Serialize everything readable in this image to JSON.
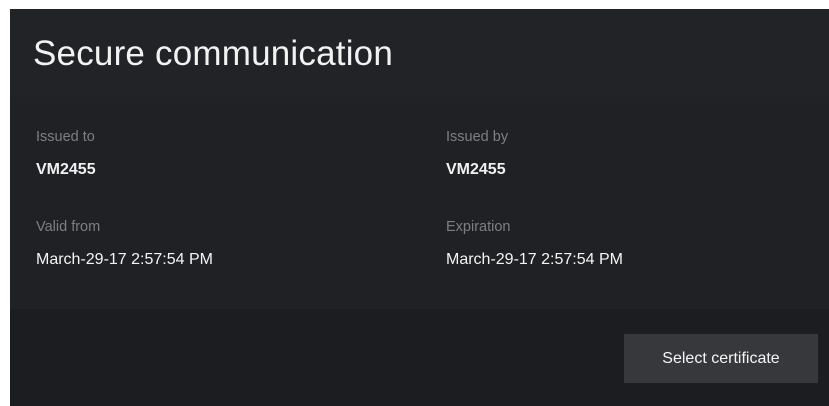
{
  "panel": {
    "title": "Secure communication"
  },
  "certificate": {
    "issued_to": {
      "label": "Issued to",
      "value": "VM2455"
    },
    "issued_by": {
      "label": "Issued by",
      "value": "VM2455"
    },
    "valid_from": {
      "label": "Valid from",
      "value": "March-29-17 2:57:54 PM"
    },
    "expiration": {
      "label": "Expiration",
      "value": "March-29-17 2:57:54 PM"
    }
  },
  "actions": {
    "select_certificate_label": "Select certificate"
  },
  "colors": {
    "panel_background": "#1f2124",
    "label_text": "#7c7f84",
    "value_text": "#f1f1f1",
    "button_background": "#36383c"
  }
}
